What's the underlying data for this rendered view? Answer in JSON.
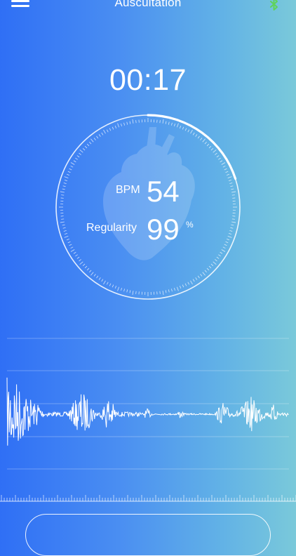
{
  "header": {
    "title": "Auscultation",
    "menu_icon": "hamburger-menu-icon",
    "status_icon": "bluetooth-icon",
    "status_icon_color": "#5fd35a"
  },
  "timer": {
    "text": "00:17"
  },
  "dial": {
    "progress_fraction": 0.2,
    "background_image": "heart-image"
  },
  "stats": {
    "bpm_label": "BPM",
    "bpm_value": "54",
    "regularity_label": "Regularity",
    "regularity_value": "99",
    "regularity_unit": "%"
  },
  "colors": {
    "gradient_start": "#2f6ff5",
    "gradient_end": "#7ac9da",
    "line": "#ffffff"
  }
}
